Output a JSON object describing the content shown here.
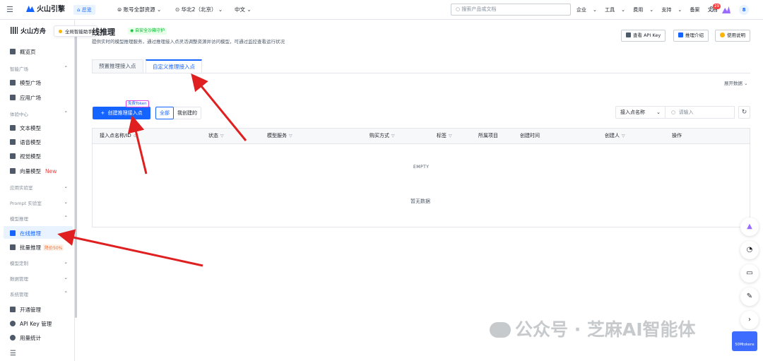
{
  "topbar": {
    "logo": "火山引擎",
    "overview": "总览",
    "account": "账号全部资源",
    "region": "华北2（北京）",
    "lang": "中文",
    "search_placeholder": "搜索产品或文档",
    "nav": [
      "企业",
      "工具",
      "费用",
      "支持",
      "备案",
      "文档"
    ],
    "badge": "29",
    "avatar": "8"
  },
  "sidebar": {
    "brand": "火山方舟",
    "items": [
      {
        "label": "概览页",
        "type": "item"
      },
      {
        "label": "智能广场",
        "type": "group"
      },
      {
        "label": "模型广场",
        "type": "item"
      },
      {
        "label": "应用广场",
        "type": "item"
      },
      {
        "label": "体验中心",
        "type": "group"
      },
      {
        "label": "文本模型",
        "type": "item"
      },
      {
        "label": "语音模型",
        "type": "item"
      },
      {
        "label": "视觉模型",
        "type": "item"
      },
      {
        "label": "向量模型",
        "type": "item",
        "tag": "New"
      },
      {
        "label": "应用实验室",
        "type": "group"
      },
      {
        "label": "Prompt 实验室",
        "type": "group"
      },
      {
        "label": "模型推理",
        "type": "group"
      },
      {
        "label": "在线推理",
        "type": "item"
      },
      {
        "label": "批量推理",
        "type": "item",
        "tag": "降价50%"
      },
      {
        "label": "模型定制",
        "type": "group"
      },
      {
        "label": "数据管理",
        "type": "group"
      },
      {
        "label": "系统管理",
        "type": "group"
      },
      {
        "label": "开通管理",
        "type": "item"
      },
      {
        "label": "API Key 管理",
        "type": "item"
      },
      {
        "label": "用量统计",
        "type": "item"
      }
    ]
  },
  "tooltip": "全局智能助手",
  "page": {
    "title": "线推理",
    "secure_tag": "自安全沙箱守护",
    "desc": "提供实时的模型推理服务，通过推理接入点灵活调整资源并访问模型，可通过监控查看运行状况",
    "buttons": [
      "查看 API Key",
      "推理介绍",
      "使用说明"
    ],
    "tabs": [
      "预置推理接入点",
      "自定义推理接入点"
    ],
    "expand": "展开数据"
  },
  "toolbar": {
    "create": "创建推理接入点",
    "free_badge": "免费Token",
    "filter_all": "全部",
    "filter_mine": "我创建的",
    "select_label": "接入点名称",
    "search_placeholder": "请输入"
  },
  "table": {
    "columns": [
      "接入点名称/ID",
      "状态",
      "模型服务",
      "购买方式",
      "标签",
      "所属项目",
      "创建时间",
      "创建人",
      "操作"
    ],
    "empty_label": "EMPTY",
    "no_data": "暂无数据"
  },
  "watermark": "公众号 · 芝麻AI智能体",
  "corner_badge": "50Mtokens",
  "colors": {
    "primary": "#1664ff",
    "arrow": "#e02020"
  }
}
